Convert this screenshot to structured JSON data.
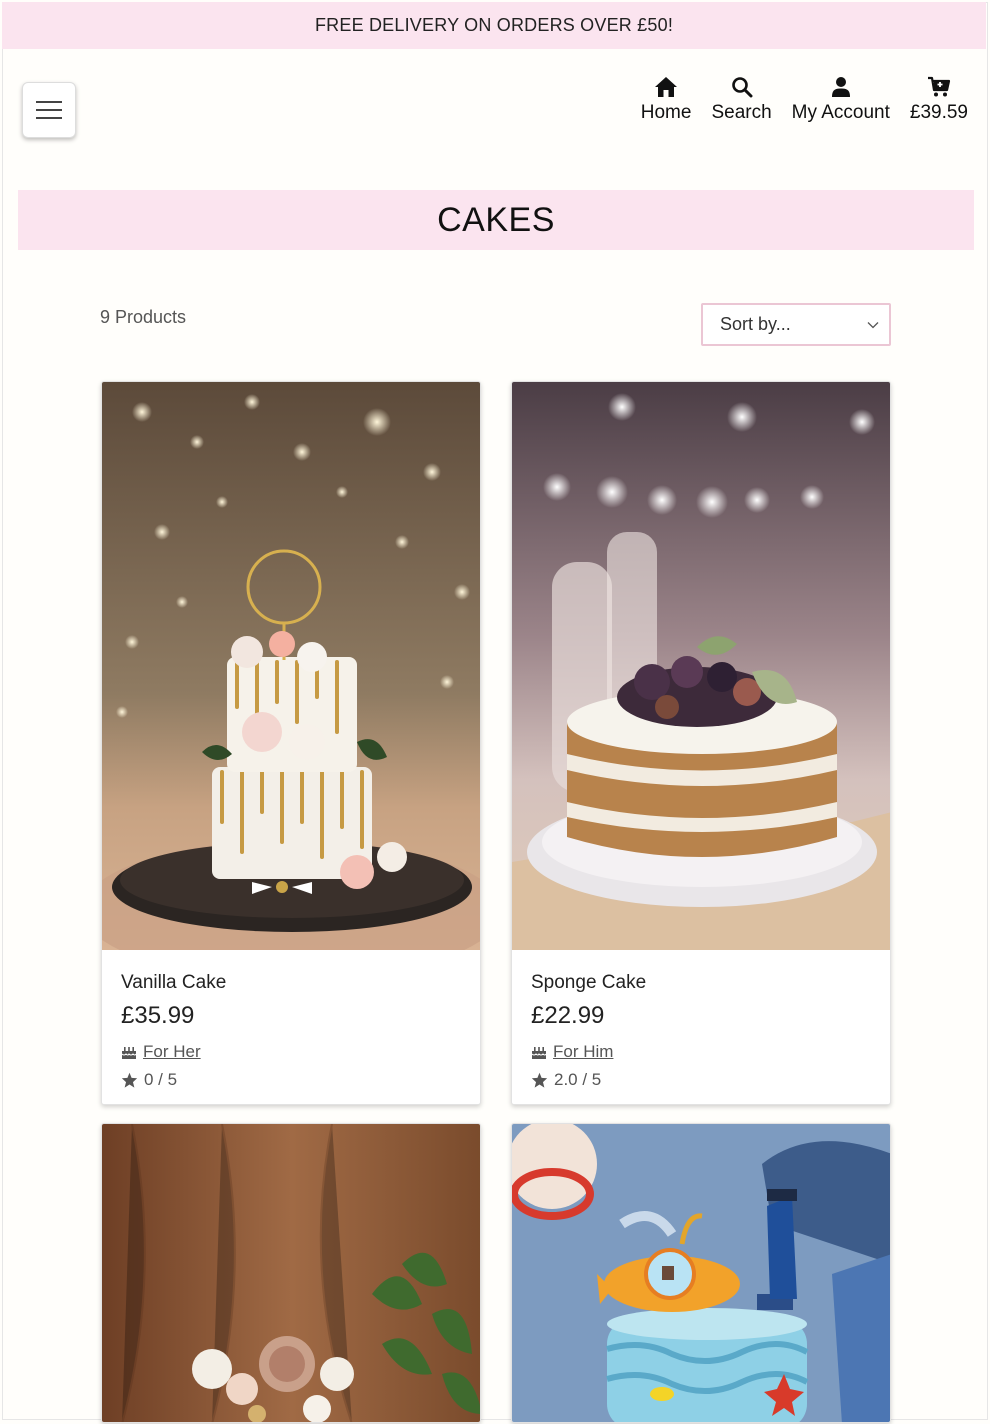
{
  "banner": {
    "text": "FREE DELIVERY ON ORDERS OVER £50!"
  },
  "nav": {
    "home_label": "Home",
    "search_label": "Search",
    "account_label": "My Account",
    "basket_total": "£39.59"
  },
  "page": {
    "title": "CAKES",
    "product_count": "9 Products"
  },
  "sort": {
    "label": "Sort by..."
  },
  "products": [
    {
      "name": "Vanilla Cake",
      "price": "£35.99",
      "category": "For Her",
      "rating": "0 / 5"
    },
    {
      "name": "Sponge Cake",
      "price": "£22.99",
      "category": "For Him",
      "rating": "2.0 / 5"
    },
    {
      "name": "",
      "price": "",
      "category": "",
      "rating": ""
    },
    {
      "name": "",
      "price": "",
      "category": "",
      "rating": ""
    }
  ],
  "colors": {
    "accent_pink": "#fbe4ef",
    "sort_border": "#ebc6d4"
  }
}
